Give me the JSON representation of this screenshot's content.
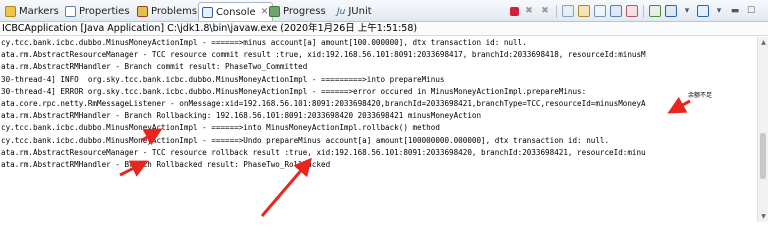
{
  "tabs": [
    {
      "label": "Markers",
      "icon": "markers-icon",
      "active": false
    },
    {
      "label": "Properties",
      "icon": "properties-icon",
      "active": false
    },
    {
      "label": "Problems",
      "icon": "problems-icon",
      "active": false
    },
    {
      "label": "Console",
      "icon": "console-icon",
      "active": true,
      "close": "✕"
    },
    {
      "label": "Progress",
      "icon": "progress-icon",
      "active": false
    },
    {
      "label": "JUnit",
      "icon": "junit-icon",
      "active": false,
      "prefix": "Ju"
    }
  ],
  "process_line": "ICBCApplication [Java Application] C:\\jdk1.8\\bin\\javaw.exe (2020年1月26日 上午1:51:58)",
  "console_lines": [
    "cy.tcc.bank.icbc.dubbo.MinusMoneyActionImpl - ======>minus account[a] amount[100.000000], dtx transaction id: null.",
    "ata.rm.AbstractResourceManager - TCC resource commit result :true, xid:192.168.56.101:8091:2033698417, branchId:2033698418, resourceId:minusM",
    "ata.rm.AbstractRMHandler - Branch commit result: PhaseTwo_Committed",
    "30-thread-4] INFO  org.sky.tcc.bank.icbc.dubbo.MinusMoneyActionImpl - =========>into prepareMinus",
    "30-thread-4] ERROR org.sky.tcc.bank.icbc.dubbo.MinusMoneyActionImpl - ======>error occured in MinusMoneyActionImpl.prepareMinus:",
    "ata.core.rpc.netty.RmMessageListener - onMessage:xid=192.168.56.101:8091:2033698420,branchId=2033698421,branchType=TCC,resourceId=minusMoneyA",
    "ata.rm.AbstractRMHandler - Branch Rollbacking: 192.168.56.101:8091:2033698420 2033698421 minusMoneyAction",
    "cy.tcc.bank.icbc.dubbo.MinusMoneyActionImpl - ======>into MinusMoneyActionImpl.rollback() method",
    "cy.tcc.bank.icbc.dubbo.MinusMoneyActionImpl - ======>Undo prepareMinus account[a] amount[100000000.000000], dtx transaction id: null.",
    "ata.rm.AbstractResourceManager - TCC resource rollback result :true, xid:192.168.56.101:8091:2033698420, branchId:2033698421, resourceId:minu",
    "ata.rm.AbstractRMHandler - Branch Rollbacked result: PhaseTwo_Rollbacked"
  ],
  "annotation_note": "余额不足",
  "scroll": {
    "up": "▲",
    "down": "▼"
  },
  "colors": {
    "accent_arrow": "#e8251f",
    "active_tab_bg": "#ffffff",
    "stop_button": "#d3203a"
  }
}
